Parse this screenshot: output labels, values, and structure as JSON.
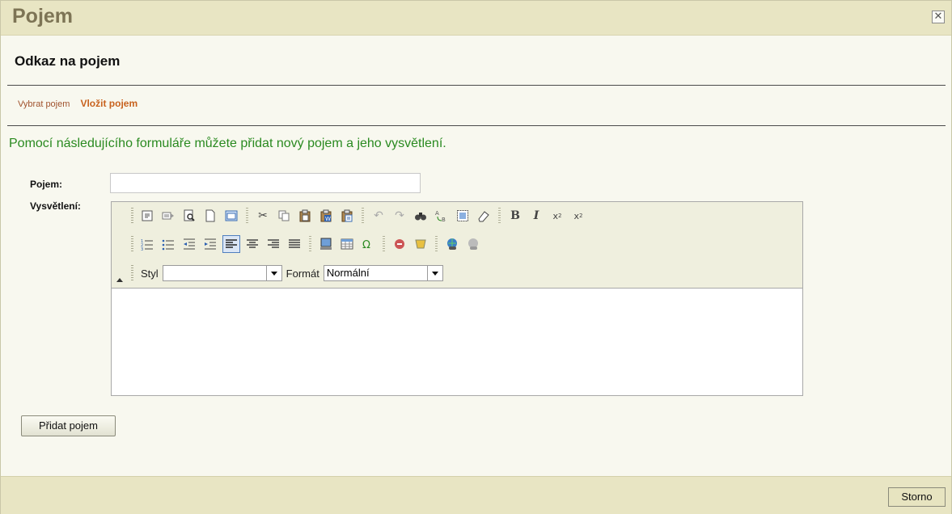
{
  "dialog": {
    "title": "Pojem",
    "close_icon": "close-box-icon"
  },
  "panel": {
    "heading": "Odkaz na pojem",
    "tabs": [
      {
        "label": "Vybrat pojem",
        "active": false
      },
      {
        "label": "Vložit pojem",
        "active": true
      }
    ],
    "intro": "Pomocí následujícího formuláře můžete přidat nový pojem a jeho vysvětlení."
  },
  "form": {
    "pojem_label": "Pojem:",
    "pojem_value": "",
    "vysvetleni_label": "Vysvětlení:",
    "toolbar": {
      "row1": [
        "source-icon",
        "template-icon",
        "preview-icon",
        "new-page-icon",
        "maximize-icon",
        "cut-icon",
        "copy-icon",
        "paste-icon",
        "paste-word-icon",
        "paste-text-icon",
        "undo-icon",
        "redo-icon",
        "find-icon",
        "replace-icon",
        "select-all-icon",
        "remove-format-icon",
        "bold-icon",
        "italic-icon",
        "subscript-icon",
        "superscript-icon"
      ],
      "row2": [
        "ordered-list-icon",
        "unordered-list-icon",
        "outdent-icon",
        "indent-icon",
        "align-left-icon",
        "align-center-icon",
        "align-right-icon",
        "justify-icon",
        "image-icon",
        "table-icon",
        "special-char-icon",
        "flash-icon",
        "anchor-icon",
        "link-icon",
        "unlink-icon"
      ],
      "style_label": "Styl",
      "style_value": "",
      "format_label": "Formát",
      "format_value": "Normální"
    },
    "submit_label": "Přidat pojem"
  },
  "footer": {
    "cancel_label": "Storno"
  },
  "colors": {
    "title": "#7d7455",
    "bar_bg": "#e8e5c3",
    "intro": "#2a8a20",
    "tab_active": "#c8621e"
  }
}
